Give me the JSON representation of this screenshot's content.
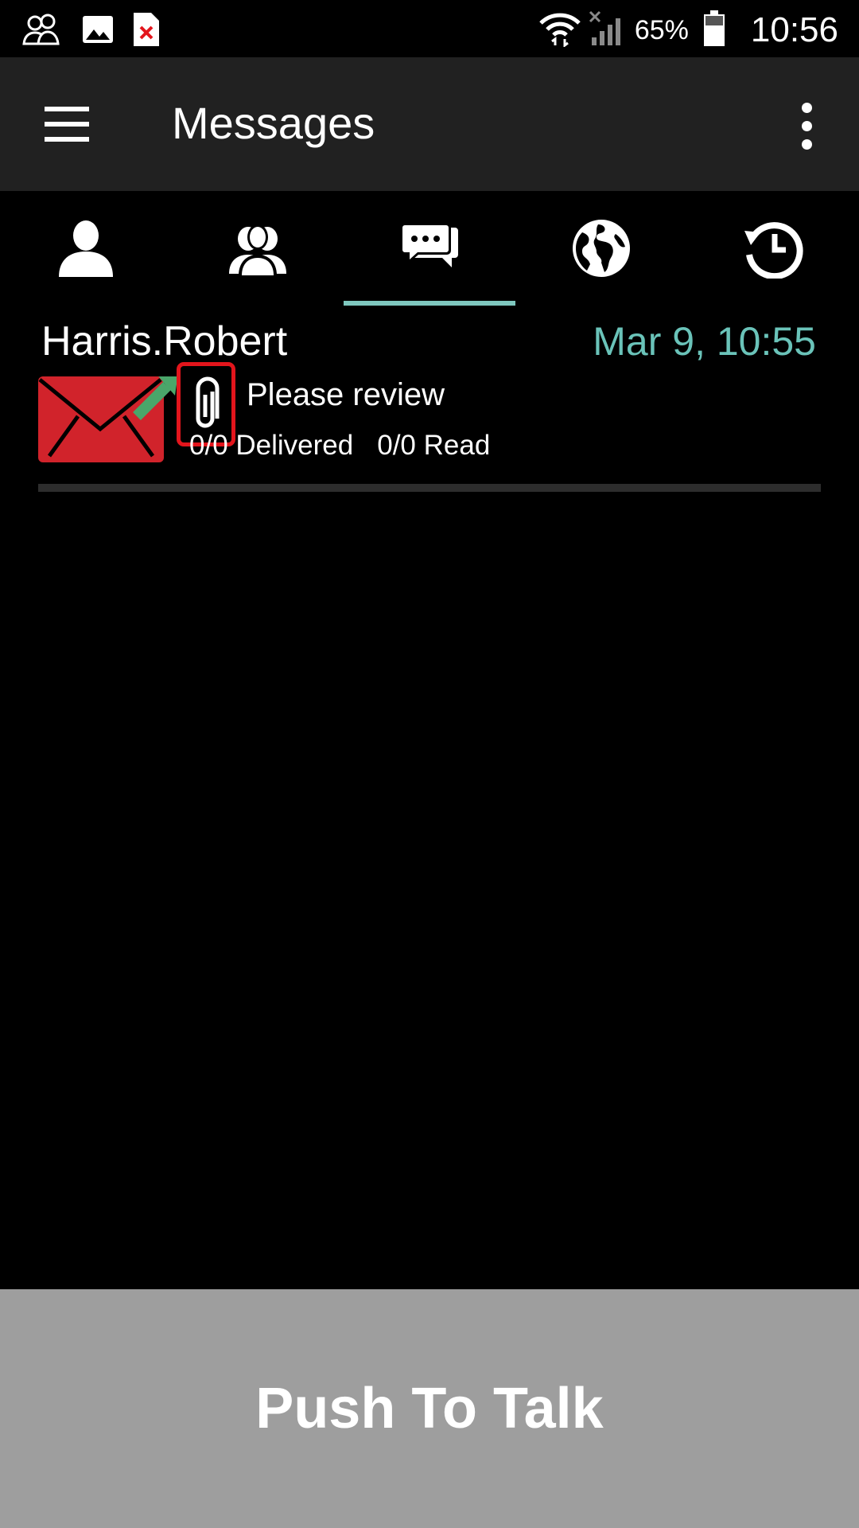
{
  "status_bar": {
    "notification_icons": [
      "contacts-notification-icon",
      "image-notification-icon",
      "file-error-notification-icon"
    ],
    "system_icons": [
      "wifi-icon",
      "signal-no-service-icon",
      "battery-icon"
    ],
    "battery_percent": "65%",
    "time": "10:56"
  },
  "app_bar": {
    "title": "Messages",
    "menu_icon": "hamburger-menu-icon",
    "overflow_icon": "more-vert-icon"
  },
  "tabs": [
    {
      "icon": "person-icon",
      "selected": false
    },
    {
      "icon": "group-icon",
      "selected": false
    },
    {
      "icon": "messages-icon",
      "selected": true
    },
    {
      "icon": "globe-icon",
      "selected": false
    },
    {
      "icon": "history-icon",
      "selected": false
    }
  ],
  "messages": [
    {
      "sender": "Harris.Robert",
      "timestamp": "Mar 9, 10:55",
      "subject": "Please review",
      "delivered": "0/0 Delivered",
      "read": "0/0 Read",
      "status_icon": "outgoing-mail-icon",
      "attachment_icon": "paperclip-icon"
    }
  ],
  "push_to_talk": {
    "label": "Push To Talk"
  },
  "colors": {
    "accent": "#7ec7be",
    "timestamp": "#6ac3b9",
    "envelope_red": "#d1232b",
    "send_arrow": "#4aa66a",
    "attachment_highlight": "#e3151c",
    "ptt_background": "#9e9e9e",
    "app_bar": "#212121"
  }
}
